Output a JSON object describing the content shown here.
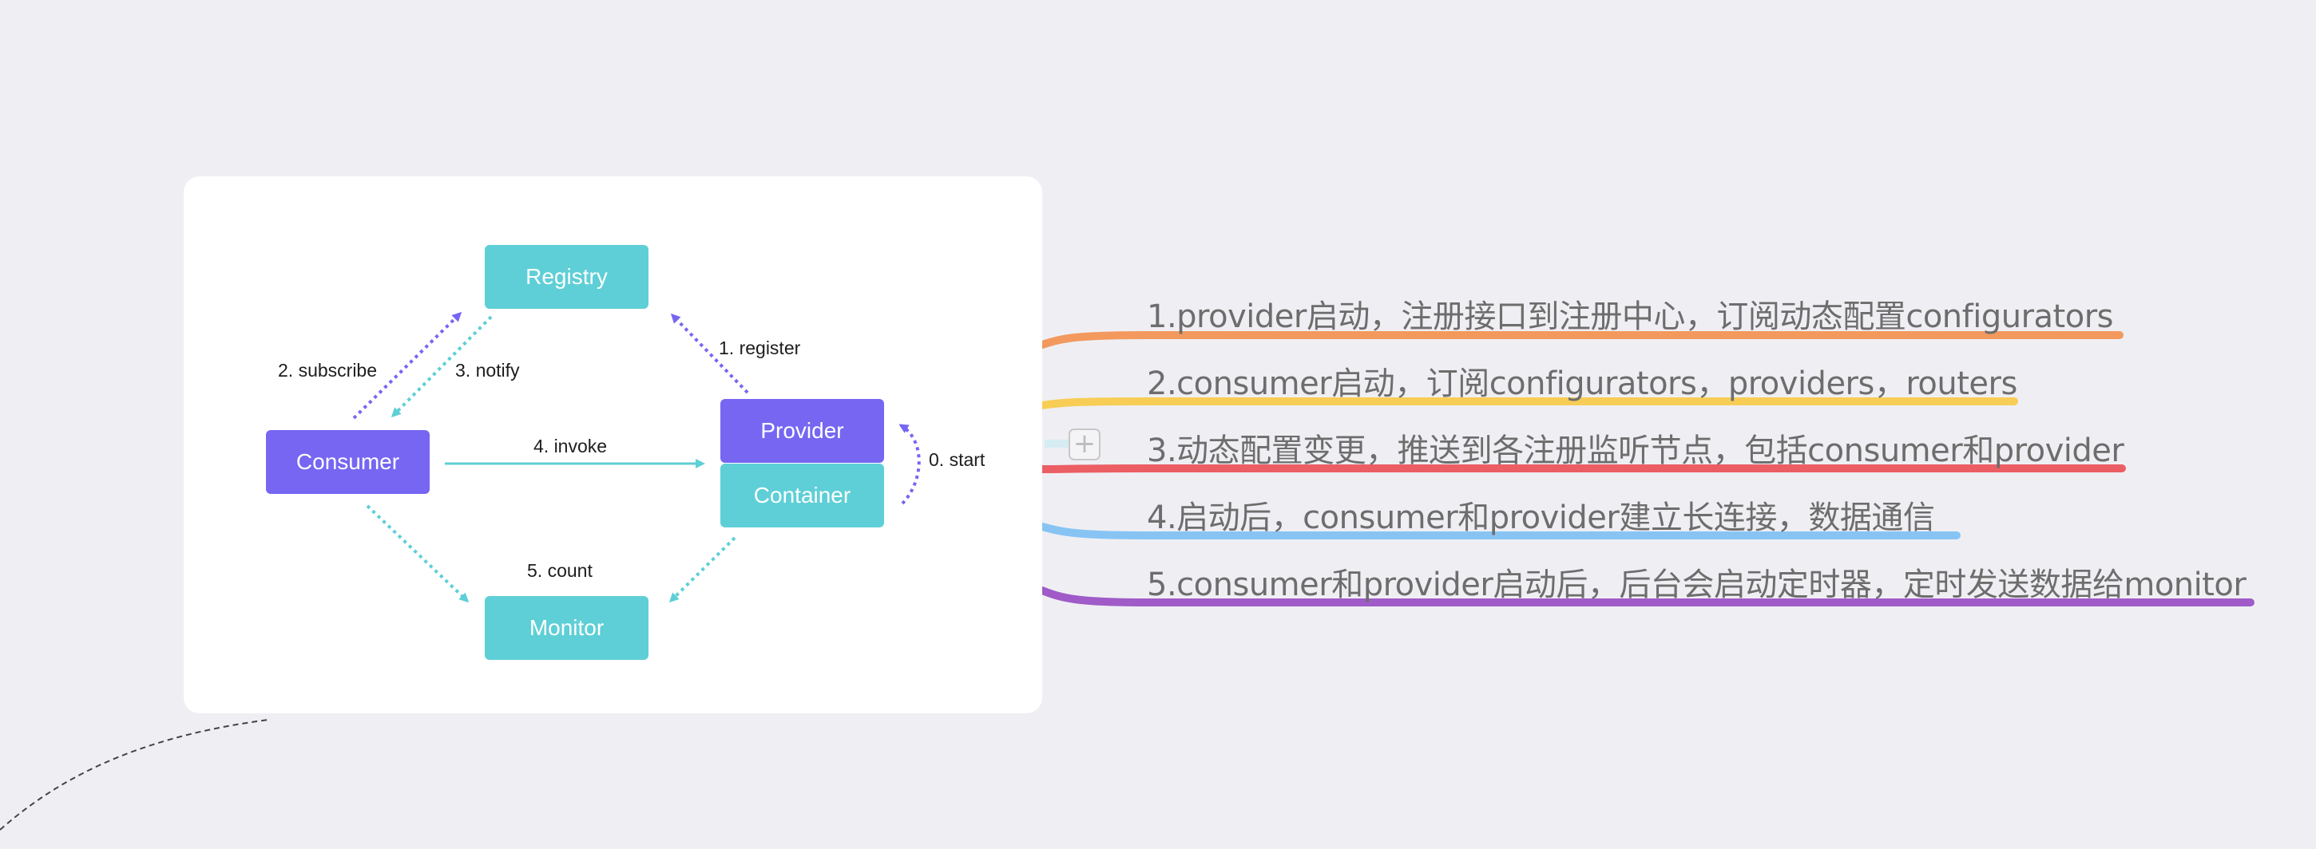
{
  "diagram": {
    "nodes": {
      "registry": "Registry",
      "consumer": "Consumer",
      "provider": "Provider",
      "container": "Container",
      "monitor": "Monitor"
    },
    "edges": {
      "start": "0. start",
      "register": "1. register",
      "subscribe": "2. subscribe",
      "notify": "3. notify",
      "invoke": "4. invoke",
      "count": "5. count"
    },
    "colors": {
      "teal": "#5ecfd6",
      "purple": "#7666f2"
    }
  },
  "notes": [
    {
      "text": "1.provider启动，注册接口到注册中心，订阅动态配置configurators",
      "color": "#f3995e"
    },
    {
      "text": "2.consumer启动，订阅configurators，providers，routers",
      "color": "#f7cd55"
    },
    {
      "text": "3.动态配置变更，推送到各注册监听节点，包括consumer和provider",
      "color": "#eb5e64"
    },
    {
      "text": "4.启动后，consumer和provider建立长连接，数据通信",
      "color": "#87c4f4"
    },
    {
      "text": "5.consumer和provider启动后，后台会启动定时器，定时发送数据给monitor",
      "color": "#a05bc8"
    }
  ],
  "collapse_symbol": "+"
}
